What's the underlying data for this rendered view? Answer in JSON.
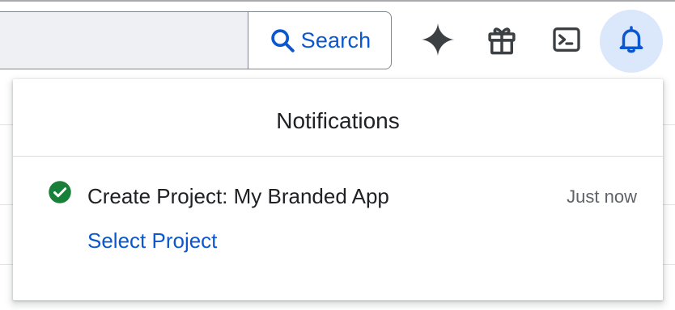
{
  "header": {
    "search_input": {
      "value": "",
      "placeholder": ""
    },
    "search_button_label": "Search",
    "icons": {
      "search": "search-icon",
      "gemini": "gemini-sparkle-icon",
      "gift": "gift-icon",
      "shell": "cloud-shell-icon",
      "notifications": "bell-icon"
    }
  },
  "notifications_panel": {
    "title": "Notifications",
    "items": [
      {
        "status_icon": "check-circle-icon",
        "status": "success",
        "text": "Create Project: My Branded App",
        "time": "Just now",
        "action_label": "Select Project"
      }
    ]
  },
  "colors": {
    "accent": "#0b57d0",
    "success": "#188038",
    "active_icon_bg": "#dbe7fb"
  }
}
